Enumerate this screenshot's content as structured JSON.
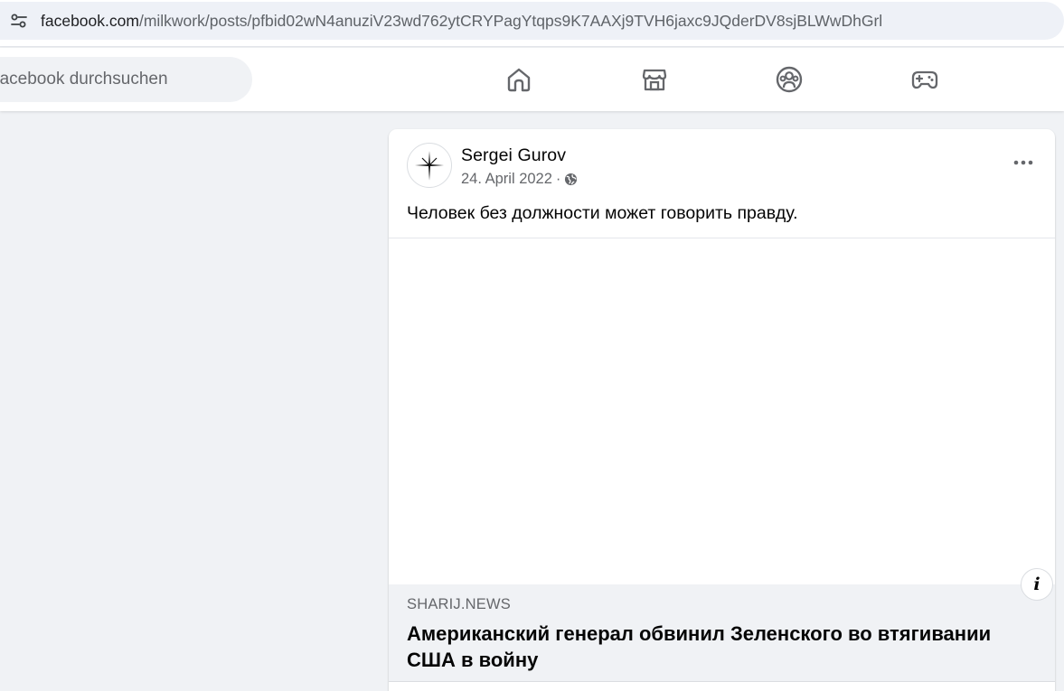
{
  "browser": {
    "url_host": "facebook.com",
    "url_path": "/milkwork/posts/pfbid02wN4anuziV23wd762ytCRYPagYtqps9K7AAXj9TVH6jaxc9JQderDV8sjBLWwDhGrl",
    "site_info_icon": "tune-icon"
  },
  "nav": {
    "search_placeholder": "Facebook durchsuchen",
    "icons": [
      "home-icon",
      "marketplace-icon",
      "groups-icon",
      "gaming-icon"
    ]
  },
  "post": {
    "author": "Sergei Gurov",
    "date": "24. April 2022",
    "separator": "·",
    "privacy_icon": "globe-icon",
    "text": "Человек без должности может говорить правду.",
    "link": {
      "domain": "SHARIJ.NEWS",
      "title": "Американский генерал обвинил Зеленского во втягивании США в войну",
      "info_label": "i"
    }
  },
  "colors": {
    "page_bg": "#f0f2f5",
    "card_bg": "#ffffff",
    "secondary_text": "#65676b",
    "primary_text": "#050505"
  }
}
